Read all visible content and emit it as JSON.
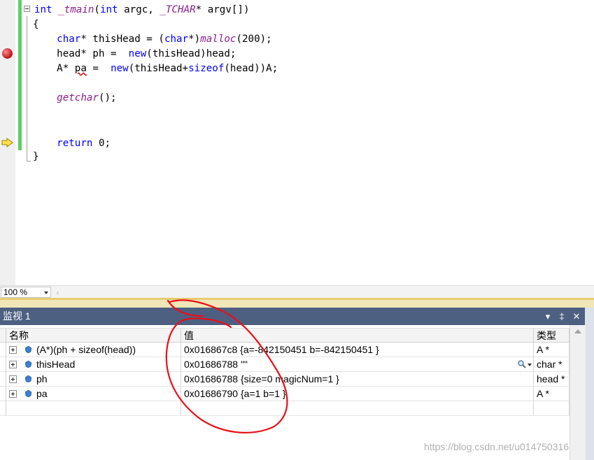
{
  "code": {
    "lines": [
      {
        "id": "l1",
        "segments": [
          {
            "t": "int",
            "c": "kw"
          },
          {
            "t": " "
          },
          {
            "t": "_tmain",
            "c": "fn"
          },
          {
            "t": "("
          },
          {
            "t": "int",
            "c": "kw"
          },
          {
            "t": " argc, "
          },
          {
            "t": "_TCHAR",
            "c": "mac"
          },
          {
            "t": "* argv[])"
          }
        ]
      },
      {
        "id": "l2",
        "segments": [
          {
            "t": "{"
          }
        ]
      },
      {
        "id": "l3",
        "segments": [
          {
            "t": "    char",
            "c": "kw"
          },
          {
            "t": "* thisHead = ("
          },
          {
            "t": "char",
            "c": "kw"
          },
          {
            "t": "*)"
          },
          {
            "t": "malloc",
            "c": "fn"
          },
          {
            "t": "(200);"
          }
        ]
      },
      {
        "id": "l4",
        "segments": [
          {
            "t": "    head* ph =  "
          },
          {
            "t": "new",
            "c": "kw"
          },
          {
            "t": "(thisHead)head;"
          }
        ]
      },
      {
        "id": "l5",
        "segments": [
          {
            "t": "    A* "
          },
          {
            "t": "pa",
            "c": "var-err"
          },
          {
            "t": " =  "
          },
          {
            "t": "new",
            "c": "kw"
          },
          {
            "t": "(thisHead+"
          },
          {
            "t": "sizeof",
            "c": "kw"
          },
          {
            "t": "(head))A;"
          }
        ]
      },
      {
        "id": "l6",
        "segments": [
          {
            "t": ""
          }
        ]
      },
      {
        "id": "l7",
        "segments": [
          {
            "t": "    "
          },
          {
            "t": "getchar",
            "c": "fn"
          },
          {
            "t": "();"
          }
        ]
      },
      {
        "id": "l8",
        "segments": [
          {
            "t": ""
          }
        ]
      },
      {
        "id": "l9",
        "segments": [
          {
            "t": ""
          }
        ]
      },
      {
        "id": "l10",
        "segments": [
          {
            "t": "    "
          },
          {
            "t": "return",
            "c": "kw"
          },
          {
            "t": " 0;"
          }
        ]
      },
      {
        "id": "l11",
        "segments": [
          {
            "t": "}"
          }
        ]
      }
    ]
  },
  "editor": {
    "zoom": "100 %",
    "hscroll_left": "‹"
  },
  "watch": {
    "title": "监视 1",
    "pin_label": "▾",
    "dock_label": "‡",
    "close_label": "✕",
    "columns": {
      "name": "名称",
      "value": "值",
      "type": "类型"
    },
    "rows": [
      {
        "name": "(A*)(ph + sizeof(head))",
        "value": "0x016867c8 {a=-842150451 b=-842150451 }",
        "type": "A *"
      },
      {
        "name": "thisHead",
        "value": "0x01686788 \"\"",
        "type": "char *"
      },
      {
        "name": "ph",
        "value": "0x01686788 {size=0 magicNum=1 }",
        "type": "head *"
      },
      {
        "name": "pa",
        "value": "0x01686790 {a=1 b=1 }",
        "type": "A *"
      }
    ]
  },
  "watermark": "https://blog.csdn.net/u014750316",
  "colors": {
    "keyword": "#0000ff",
    "function": "#8a1f8a",
    "panel_title": "#4d6082",
    "annotation": "#e8101a"
  }
}
